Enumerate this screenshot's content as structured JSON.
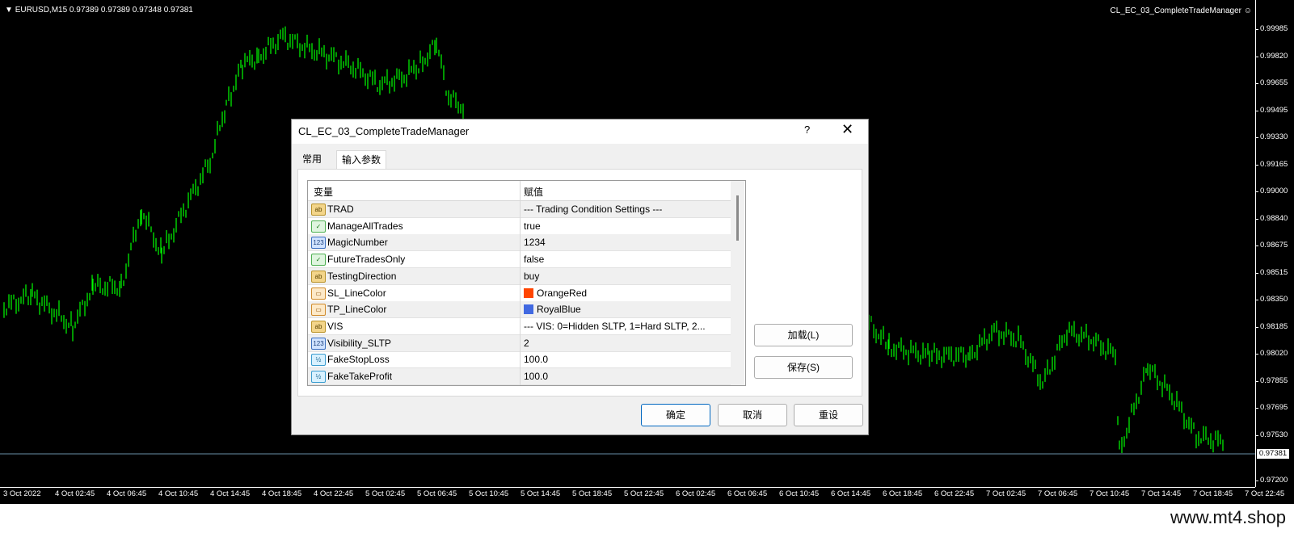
{
  "chart": {
    "info": "EURUSD,M15  0.97389 0.97389 0.97348 0.97381",
    "ea_name": "CL_EC_03_CompleteTradeManager",
    "current_price": "0.97381",
    "price_labels": [
      "0.99985",
      "0.99820",
      "0.99655",
      "0.99495",
      "0.99330",
      "0.99165",
      "0.99000",
      "0.98840",
      "0.98675",
      "0.98515",
      "0.98350",
      "0.98185",
      "0.98020",
      "0.97855",
      "0.97695",
      "0.97530",
      "0.97200"
    ],
    "time_labels": [
      "3 Oct 2022",
      "4 Oct 02:45",
      "4 Oct 06:45",
      "4 Oct 10:45",
      "4 Oct 14:45",
      "4 Oct 18:45",
      "4 Oct 22:45",
      "5 Oct 02:45",
      "5 Oct 06:45",
      "5 Oct 10:45",
      "5 Oct 14:45",
      "5 Oct 18:45",
      "5 Oct 22:45",
      "6 Oct 02:45",
      "6 Oct 06:45",
      "6 Oct 10:45",
      "6 Oct 14:45",
      "6 Oct 18:45",
      "6 Oct 22:45",
      "7 Oct 02:45",
      "7 Oct 06:45",
      "7 Oct 10:45",
      "7 Oct 14:45",
      "7 Oct 18:45",
      "7 Oct 22:45"
    ],
    "candle_color": "#00ff00",
    "background": "#000000"
  },
  "dialog": {
    "title": "CL_EC_03_CompleteTradeManager",
    "help": "?",
    "close": "✕",
    "tabs": [
      "常用",
      "输入参数"
    ],
    "active_tab": "输入参数",
    "columns": [
      "变量",
      "赋值"
    ],
    "params": [
      {
        "icon": "ab",
        "name": "TRAD",
        "value": "--- Trading Condition Settings ---"
      },
      {
        "icon": "bool",
        "name": "ManageAllTrades",
        "value": "true"
      },
      {
        "icon": "123",
        "name": "MagicNumber",
        "value": "1234"
      },
      {
        "icon": "bool",
        "name": "FutureTradesOnly",
        "value": "false"
      },
      {
        "icon": "ab",
        "name": "TestingDirection",
        "value": "buy"
      },
      {
        "icon": "color",
        "name": "SL_LineColor",
        "value": "OrangeRed",
        "swatch": "#ff4500"
      },
      {
        "icon": "color",
        "name": "TP_LineColor",
        "value": "RoyalBlue",
        "swatch": "#4169e1"
      },
      {
        "icon": "ab",
        "name": "VIS",
        "value": "--- VIS: 0=Hidden SLTP, 1=Hard SLTP, 2..."
      },
      {
        "icon": "123",
        "name": "Visibility_SLTP",
        "value": "2"
      },
      {
        "icon": "1/2",
        "name": "FakeStopLoss",
        "value": "100.0"
      },
      {
        "icon": "1/2",
        "name": "FakeTakeProfit",
        "value": "100.0"
      }
    ],
    "buttons": {
      "load": "加载(L)",
      "save": "保存(S)",
      "ok": "确定",
      "cancel": "取消",
      "reset": "重设"
    }
  },
  "watermark": "www.mt4.shop"
}
